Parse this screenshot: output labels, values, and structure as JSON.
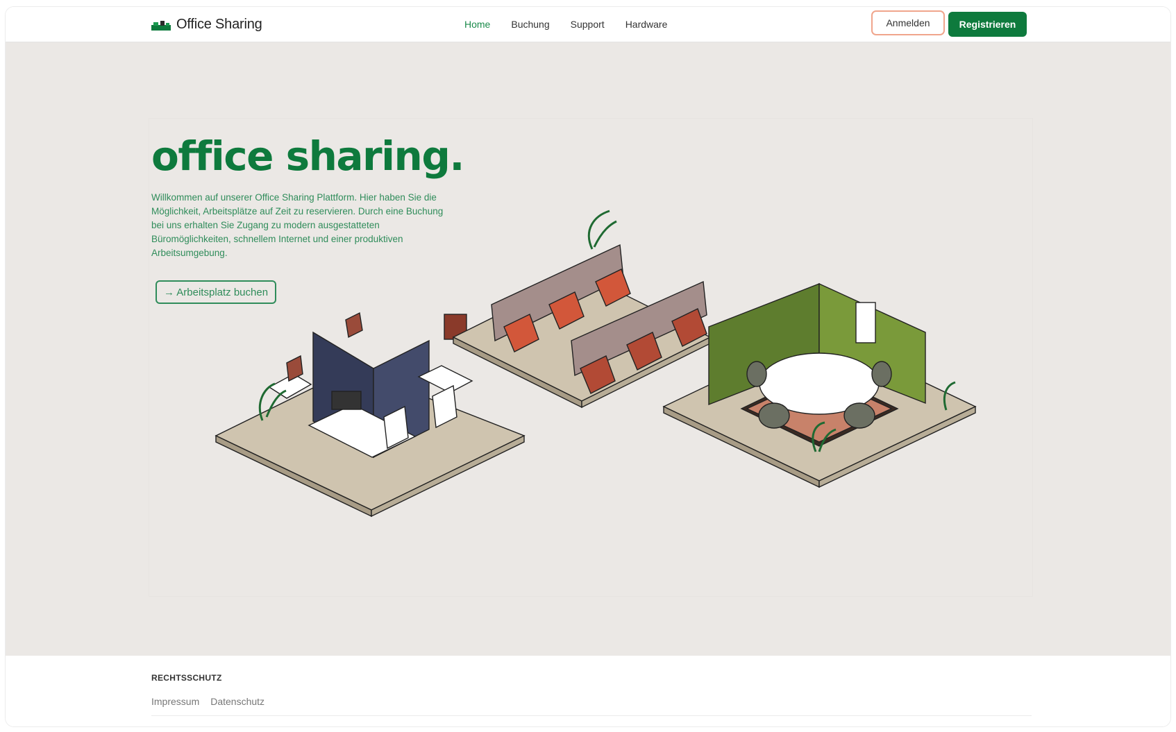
{
  "header": {
    "brand": "Office Sharing",
    "nav": [
      {
        "label": "Home",
        "active": true
      },
      {
        "label": "Buchung",
        "active": false
      },
      {
        "label": "Support",
        "active": false
      },
      {
        "label": "Hardware",
        "active": false
      }
    ],
    "login_label": "Anmelden",
    "register_label": "Registrieren"
  },
  "hero": {
    "title": "office sharing.",
    "text": "Willkommen auf unserer Office Sharing Plattform. Hier haben Sie die Möglichkeit, Arbeitsplätze auf Zeit zu reservieren. Durch eine Buchung bei uns erhalten Sie Zugang zu modern ausgestatteten Büromöglichkeiten, schnellem Internet und einer produktiven Arbeitsumgebung.",
    "cta_label": "→ Arbeitsplatz buchen",
    "illustration": "isometric-office-illustration"
  },
  "footer": {
    "heading": "RECHTSSCHUTZ",
    "links": [
      "Impressum",
      "Datenschutz"
    ]
  },
  "colors": {
    "brand_green": "#0e7a3d",
    "hero_bg": "#ebe8e5",
    "login_border": "#f0a58c"
  },
  "icons": {
    "logo": "office-logo-icon"
  }
}
